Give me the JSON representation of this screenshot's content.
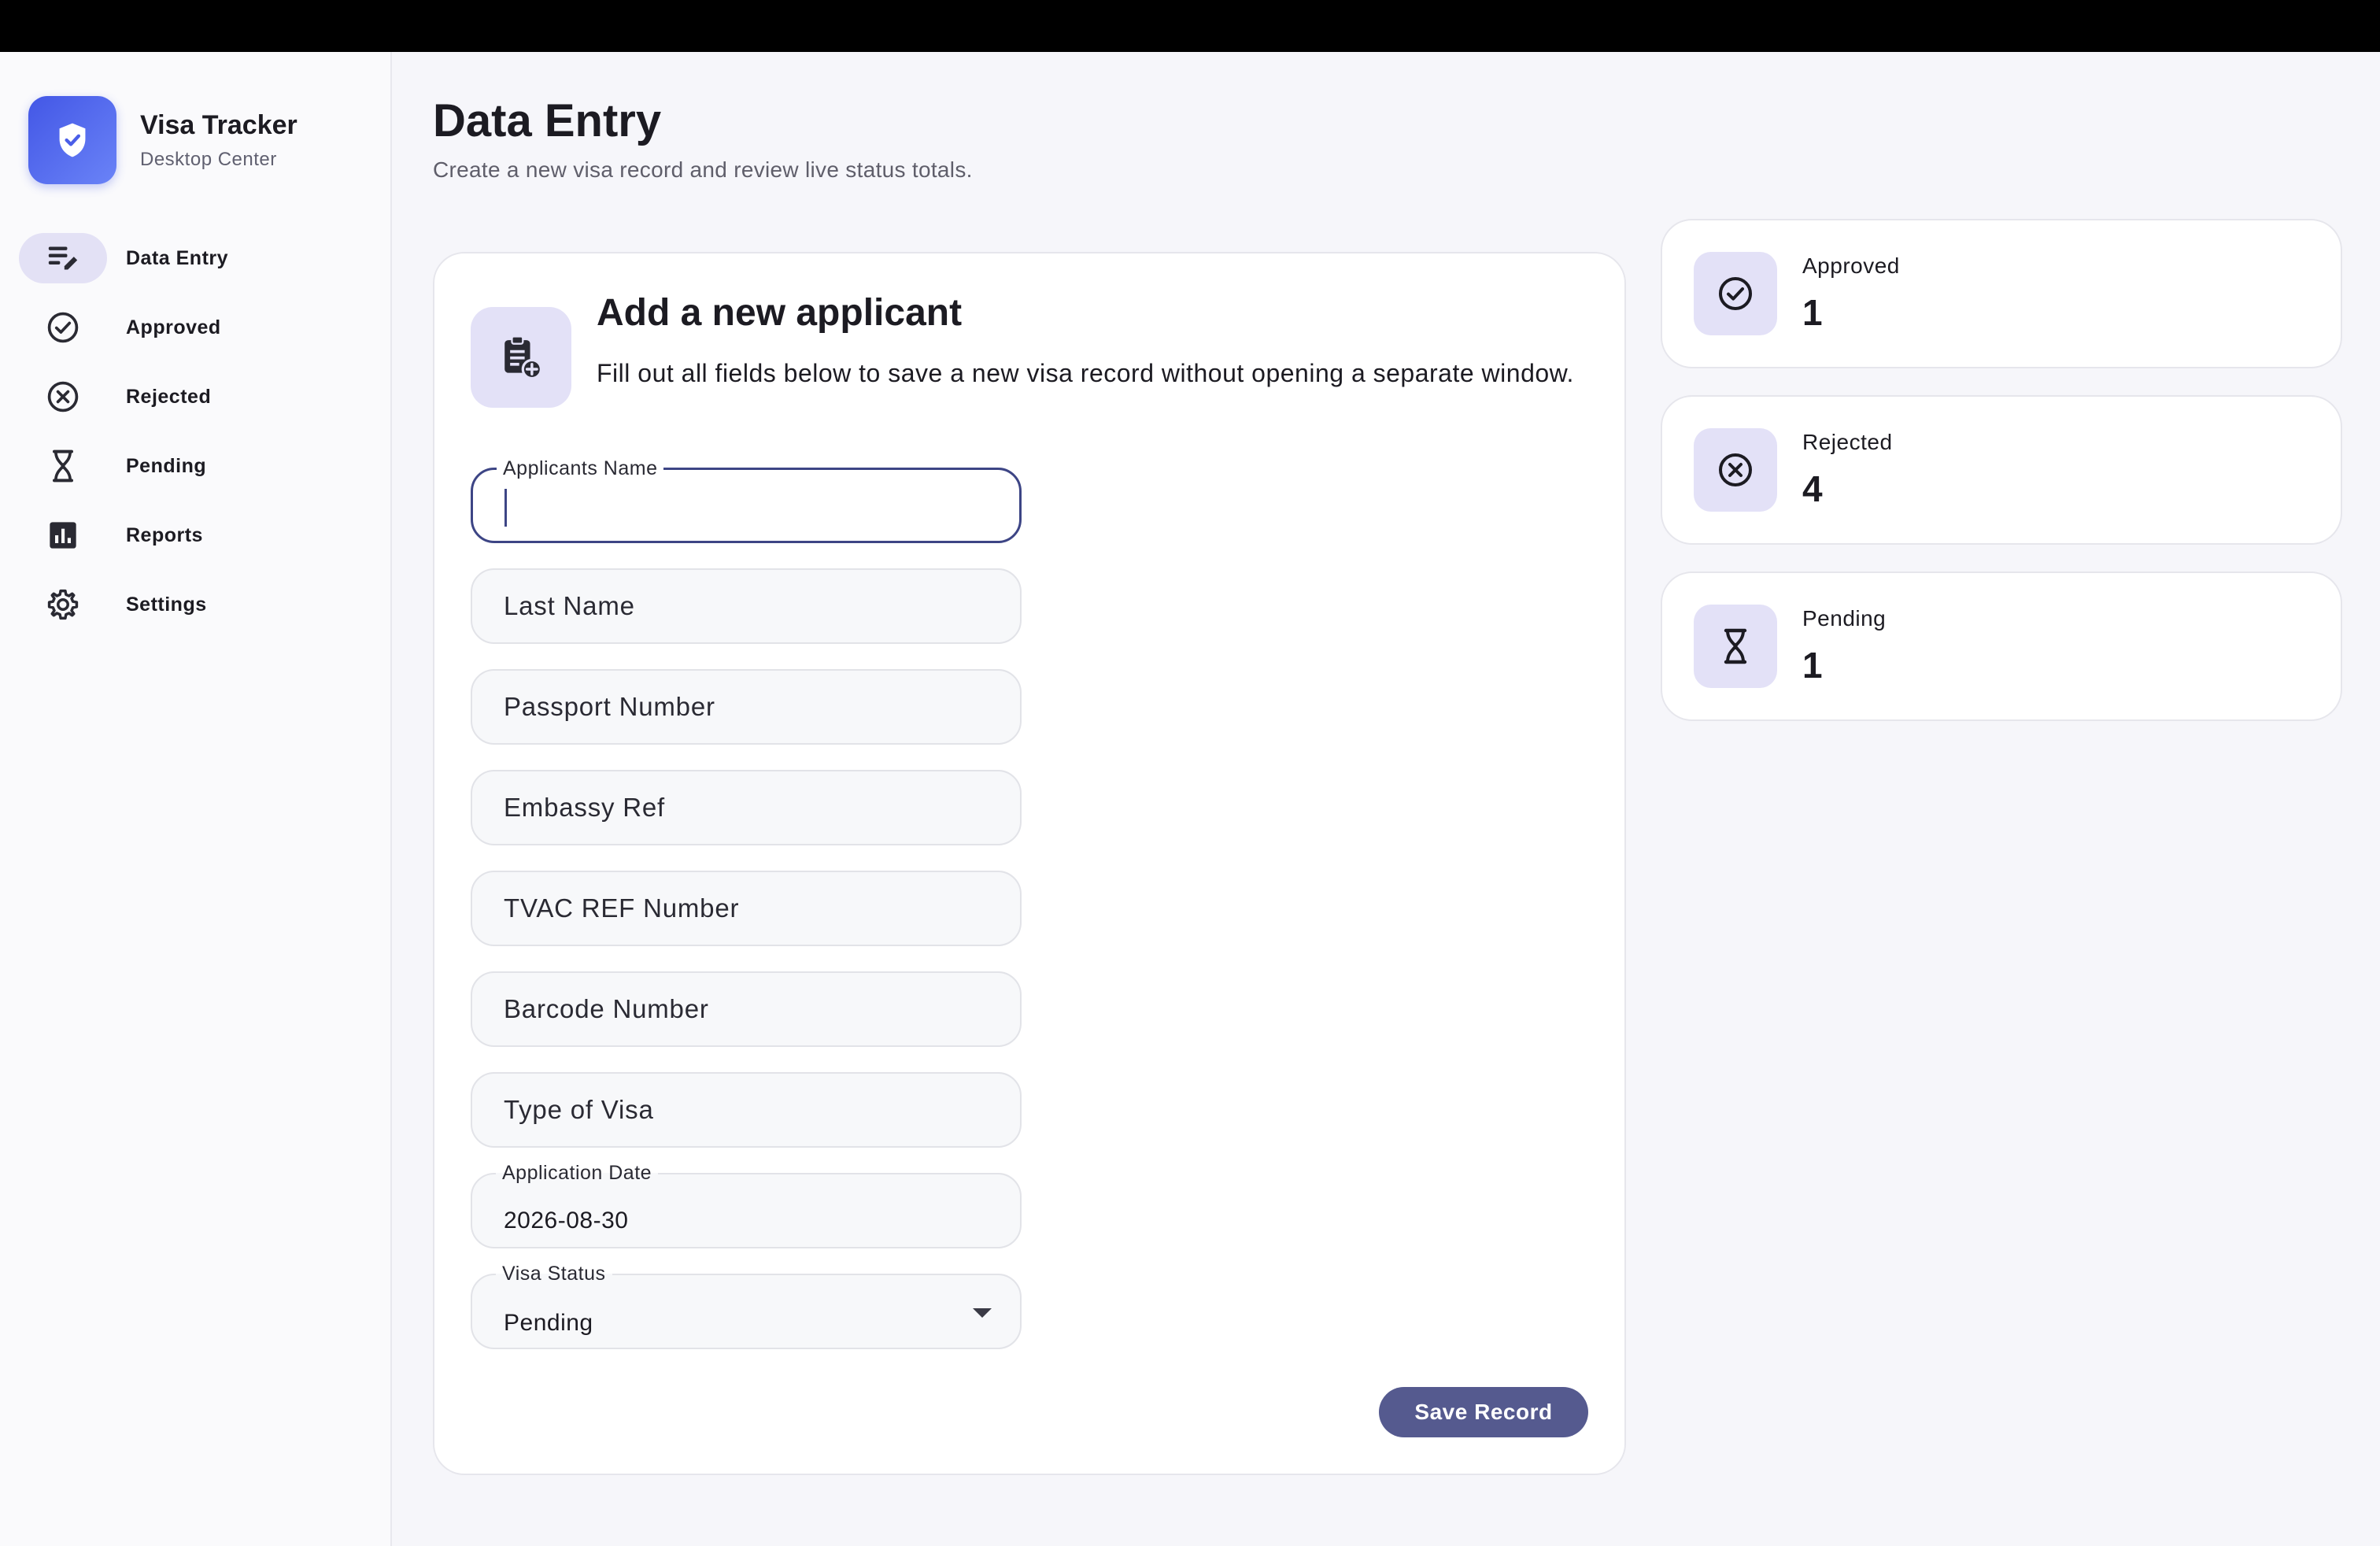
{
  "brand": {
    "title": "Visa Tracker",
    "subtitle": "Desktop Center"
  },
  "nav": [
    {
      "label": "Data Entry",
      "icon": "edit-note-icon",
      "active": true
    },
    {
      "label": "Approved",
      "icon": "check-circle-icon"
    },
    {
      "label": "Rejected",
      "icon": "cancel-circle-icon"
    },
    {
      "label": "Pending",
      "icon": "hourglass-icon"
    },
    {
      "label": "Reports",
      "icon": "bar-chart-icon"
    },
    {
      "label": "Settings",
      "icon": "gear-icon"
    }
  ],
  "page": {
    "title": "Data Entry",
    "subtitle": "Create a new visa record and review live status totals."
  },
  "form": {
    "title": "Add a new applicant",
    "description": "Fill out all fields below to save a new visa record without opening a separate window.",
    "fields": {
      "applicant_name_label": "Applicants Name",
      "applicant_name_value": "",
      "last_name_placeholder": "Last Name",
      "passport_placeholder": "Passport Number",
      "embassy_placeholder": "Embassy Ref",
      "tvac_placeholder": "TVAC REF Number",
      "barcode_placeholder": "Barcode Number",
      "visa_type_placeholder": "Type of Visa",
      "application_date_label": "Application Date",
      "application_date_value": "2026-08-30",
      "visa_status_label": "Visa Status",
      "visa_status_value": "Pending"
    },
    "save_label": "Save Record"
  },
  "stats": [
    {
      "label": "Approved",
      "value": "1",
      "icon": "check-circle-icon"
    },
    {
      "label": "Rejected",
      "value": "4",
      "icon": "cancel-circle-icon"
    },
    {
      "label": "Pending",
      "value": "1",
      "icon": "hourglass-icon"
    }
  ],
  "colors": {
    "accent": "#555a8f",
    "brand_gradient_start": "#4357e6",
    "brand_gradient_end": "#6a83f7",
    "icon_tile": "#e3e1f7"
  }
}
